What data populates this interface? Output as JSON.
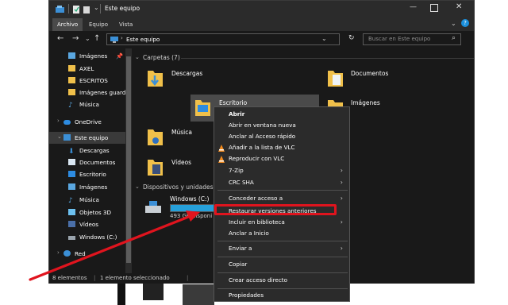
{
  "window": {
    "title": "Este equipo",
    "ribbon_tabs": [
      "Archivo",
      "Equipo",
      "Vista"
    ],
    "address": "Este equipo",
    "search_placeholder": "Buscar en Este equipo"
  },
  "sidebar": {
    "items": [
      {
        "label": "Imágenes",
        "icon": "pictures-icon"
      },
      {
        "label": "AXEL",
        "icon": "folder-icon"
      },
      {
        "label": "ESCRITOS",
        "icon": "folder-icon"
      },
      {
        "label": "Imágenes guard",
        "icon": "folder-icon"
      },
      {
        "label": "Música",
        "icon": "music-icon"
      },
      {
        "label": "OneDrive",
        "icon": "cloud-icon"
      },
      {
        "label": "Este equipo",
        "icon": "computer-icon"
      },
      {
        "label": "Descargas",
        "icon": "download-icon"
      },
      {
        "label": "Documentos",
        "icon": "documents-icon"
      },
      {
        "label": "Escritorio",
        "icon": "desktop-icon"
      },
      {
        "label": "Imágenes",
        "icon": "pictures-icon"
      },
      {
        "label": "Música",
        "icon": "music-icon"
      },
      {
        "label": "Objetos 3D",
        "icon": "cube-icon"
      },
      {
        "label": "Vídeos",
        "icon": "video-icon"
      },
      {
        "label": "Windows (C:)",
        "icon": "drive-icon"
      },
      {
        "label": "Red",
        "icon": "network-icon"
      }
    ]
  },
  "main": {
    "folders_header": "Carpetas (7)",
    "folders": [
      "Descargas",
      "Documentos",
      "Escritorio",
      "Imágenes",
      "Música",
      "Vídeos"
    ],
    "devices_header": "Dispositivos y unidades (",
    "drive_name": "Windows (C:)",
    "drive_free": "493 GB disponi",
    "drive_used_fraction": 0.55
  },
  "status": {
    "items_count": "8 elementos",
    "selected": "1 elemento seleccionado"
  },
  "context_menu": {
    "items": [
      {
        "label": "Abrir",
        "bold": true
      },
      {
        "label": "Abrir en ventana nueva"
      },
      {
        "label": "Anclar al Acceso rápido"
      },
      {
        "label": "Añadir a la lista de VLC",
        "icon": "vlc-icon"
      },
      {
        "label": "Reproducir con VLC",
        "icon": "vlc-icon"
      },
      {
        "label": "7-Zip",
        "submenu": true
      },
      {
        "label": "CRC SHA",
        "submenu": true
      },
      {
        "label": "Conceder acceso a",
        "submenu": true
      },
      {
        "label": "Restaurar versiones anteriores",
        "highlighted": true
      },
      {
        "label": "Incluir en biblioteca",
        "submenu": true
      },
      {
        "label": "Anclar a Inicio"
      },
      {
        "label": "Enviar a",
        "submenu": true
      },
      {
        "label": "Copiar"
      },
      {
        "label": "Crear acceso directo"
      },
      {
        "label": "Propiedades"
      }
    ]
  },
  "colors": {
    "accent": "#1a8fdc",
    "highlight": "#e0141e",
    "folder": "#f0c04a"
  }
}
